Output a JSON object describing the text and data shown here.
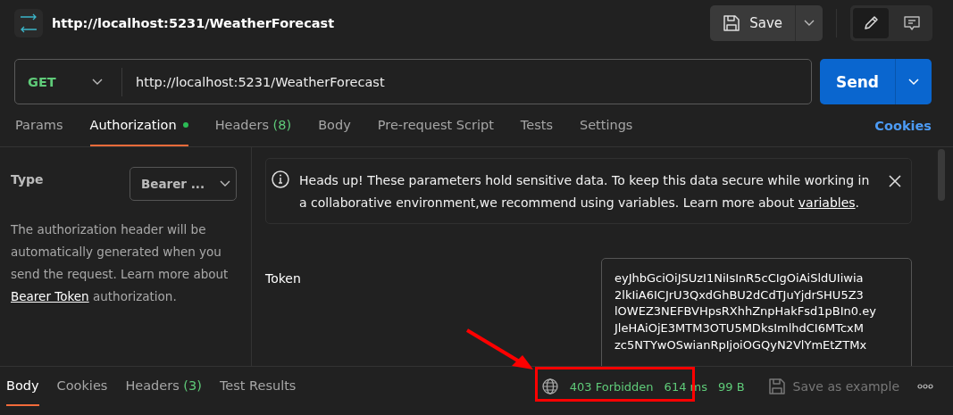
{
  "header": {
    "title": "http://localhost:5231/WeatherForecast",
    "save_label": "Save"
  },
  "request": {
    "method": "GET",
    "url": "http://localhost:5231/WeatherForecast",
    "send_label": "Send"
  },
  "request_tabs": [
    {
      "label": "Params",
      "selected": false
    },
    {
      "label": "Authorization",
      "selected": true,
      "dot": true
    },
    {
      "label": "Headers",
      "count": "(8)",
      "selected": false
    },
    {
      "label": "Body",
      "selected": false
    },
    {
      "label": "Pre-request Script",
      "selected": false
    },
    {
      "label": "Tests",
      "selected": false
    },
    {
      "label": "Settings",
      "selected": false
    }
  ],
  "cookies_link": "Cookies",
  "auth": {
    "type_label": "Type",
    "type_value": "Bearer ...",
    "description": "The authorization header will be automatically generated when you send the request. Learn more about ",
    "link": "Bearer Token",
    "description_end": " authorization."
  },
  "notice": {
    "text": "Heads up! These parameters hold sensitive data. To keep this data secure while working in a collaborative environment,we recommend using variables. Learn more about ",
    "link": "variables",
    "end": "."
  },
  "token": {
    "label": "Token",
    "lines": [
      "eyJhbGciOiJSUzI1NiIsInR5cCIgOiAiSldUIiwia",
      "2lkIiA6ICJrU3QxdGhBU2dCdTJuYjdrSHU5Z3",
      "lOWEZ3NEFBVHpsRXhhZnpHakFsd1pBIn0.ey",
      "JleHAiOjE3MTM3OTU5MDksImlhdCI6MTcxM",
      "zc5NTYwOSwianRpIjoiOGQyN2VlYmEtZTMx"
    ]
  },
  "response_tabs": [
    {
      "label": "Body",
      "selected": true
    },
    {
      "label": "Cookies",
      "selected": false
    },
    {
      "label": "Headers",
      "count": "(3)",
      "selected": false
    },
    {
      "label": "Test Results",
      "selected": false
    }
  ],
  "response_status": {
    "status": "403 Forbidden",
    "time": "614 ms",
    "size": "99 B",
    "save_example": "Save as example"
  }
}
